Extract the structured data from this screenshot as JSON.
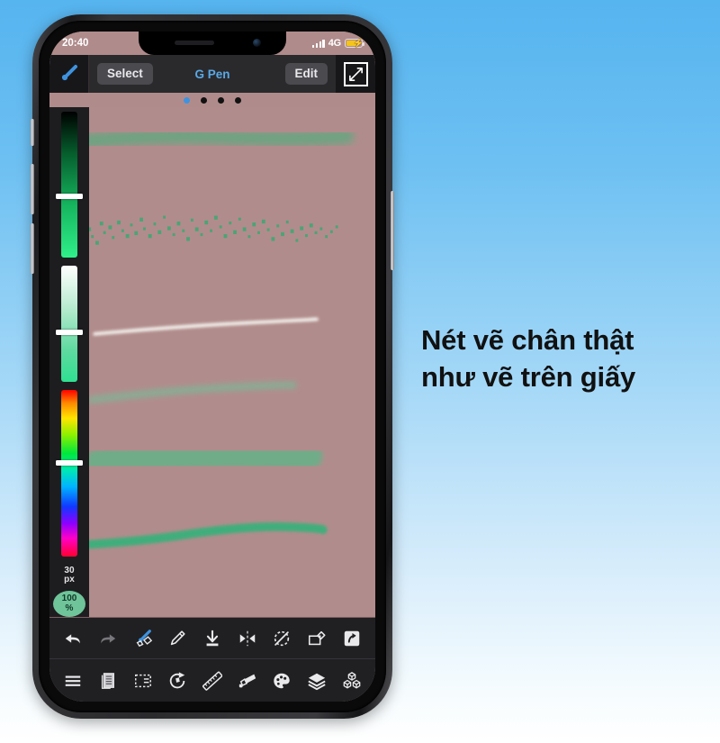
{
  "background": {
    "top_color": "#56b4ef",
    "bottom_color": "#ffffff"
  },
  "headline": {
    "line1": "Nét vẽ chân thật",
    "line2": "như vẽ trên giấy",
    "color": "#111111"
  },
  "phone": {
    "status_bar": {
      "time": "20:40",
      "network": "4G",
      "signal_icon": "signal-bars-icon",
      "battery_icon": "battery-charging-icon",
      "battery_color": "#f5c518",
      "text_color": "#ffffff"
    },
    "side_buttons": [
      "mute-switch",
      "volume-up-button",
      "volume-down-button",
      "power-button"
    ]
  },
  "app": {
    "toolbar": {
      "brush_tool_icon": "paintbrush-icon",
      "brush_tool_color": "#3f93de",
      "select_label": "Select",
      "brush_name": "G Pen",
      "brush_name_color": "#5aa9e6",
      "edit_label": "Edit",
      "expand_icon": "expand-diagonal-icon"
    },
    "page_dots": {
      "count": 4,
      "active_index": 0,
      "active_color": "#3f93de",
      "inactive_color": "#111111"
    },
    "color_sidebar": {
      "sliders": [
        {
          "name": "value-slider",
          "handle_percent": 58,
          "top_color": "#000000",
          "bottom_color": "#2ff08a"
        },
        {
          "name": "saturation-slider",
          "handle_percent": 57,
          "top_color": "#ffffff",
          "bottom_color": "#2fe091"
        },
        {
          "name": "hue-slider",
          "handle_percent": 43,
          "top_color": "#ff0000",
          "bottom_color": "#ff0030"
        }
      ],
      "brush_size_value": "30",
      "brush_size_unit": "px",
      "opacity_value": "100",
      "opacity_unit": "%",
      "opacity_badge_color": "#6fc49a"
    },
    "canvas": {
      "background_color": "#b18c8c",
      "strokes": [
        {
          "name": "soft-airbrush-stroke",
          "style": "blurred-wide",
          "color": "#5fa87f"
        },
        {
          "name": "spray-dots-stroke",
          "style": "scattered-dots",
          "color": "#4aa877"
        },
        {
          "name": "white-thin-stroke",
          "style": "thin-line",
          "color": "#f7f7f2"
        },
        {
          "name": "light-tapered-stroke",
          "style": "tapered",
          "color": "#77b493"
        },
        {
          "name": "thick-marker-stroke",
          "style": "thick-soft",
          "color": "#6aaf88"
        },
        {
          "name": "textured-pen-stroke",
          "style": "textured",
          "color": "#3fae7c"
        }
      ]
    },
    "bottom_toolbar": {
      "row1": [
        {
          "name": "undo-icon",
          "label": "Undo",
          "state": "enabled"
        },
        {
          "name": "redo-icon",
          "label": "Redo",
          "state": "disabled"
        },
        {
          "name": "brush-shape-icon",
          "label": "Brush Shape",
          "state": "active"
        },
        {
          "name": "eyedropper-icon",
          "label": "Eyedropper",
          "state": "enabled"
        },
        {
          "name": "import-icon",
          "label": "Import",
          "state": "enabled"
        },
        {
          "name": "mirror-icon",
          "label": "Mirror",
          "state": "enabled"
        },
        {
          "name": "no-rotate-icon",
          "label": "Rotate Off",
          "state": "enabled"
        },
        {
          "name": "transform-icon",
          "label": "Transform",
          "state": "enabled"
        },
        {
          "name": "share-icon",
          "label": "Share",
          "state": "filled"
        }
      ],
      "row2": [
        {
          "name": "menu-icon",
          "label": "Menu"
        },
        {
          "name": "pages-icon",
          "label": "Pages"
        },
        {
          "name": "selection-icon",
          "label": "Selection"
        },
        {
          "name": "rotate-icon",
          "label": "Rotate"
        },
        {
          "name": "ruler-icon",
          "label": "Ruler"
        },
        {
          "name": "gradient-icon",
          "label": "Gradient"
        },
        {
          "name": "palette-icon",
          "label": "Palette"
        },
        {
          "name": "layers-icon",
          "label": "Layers"
        },
        {
          "name": "materials-icon",
          "label": "Materials"
        }
      ]
    }
  }
}
